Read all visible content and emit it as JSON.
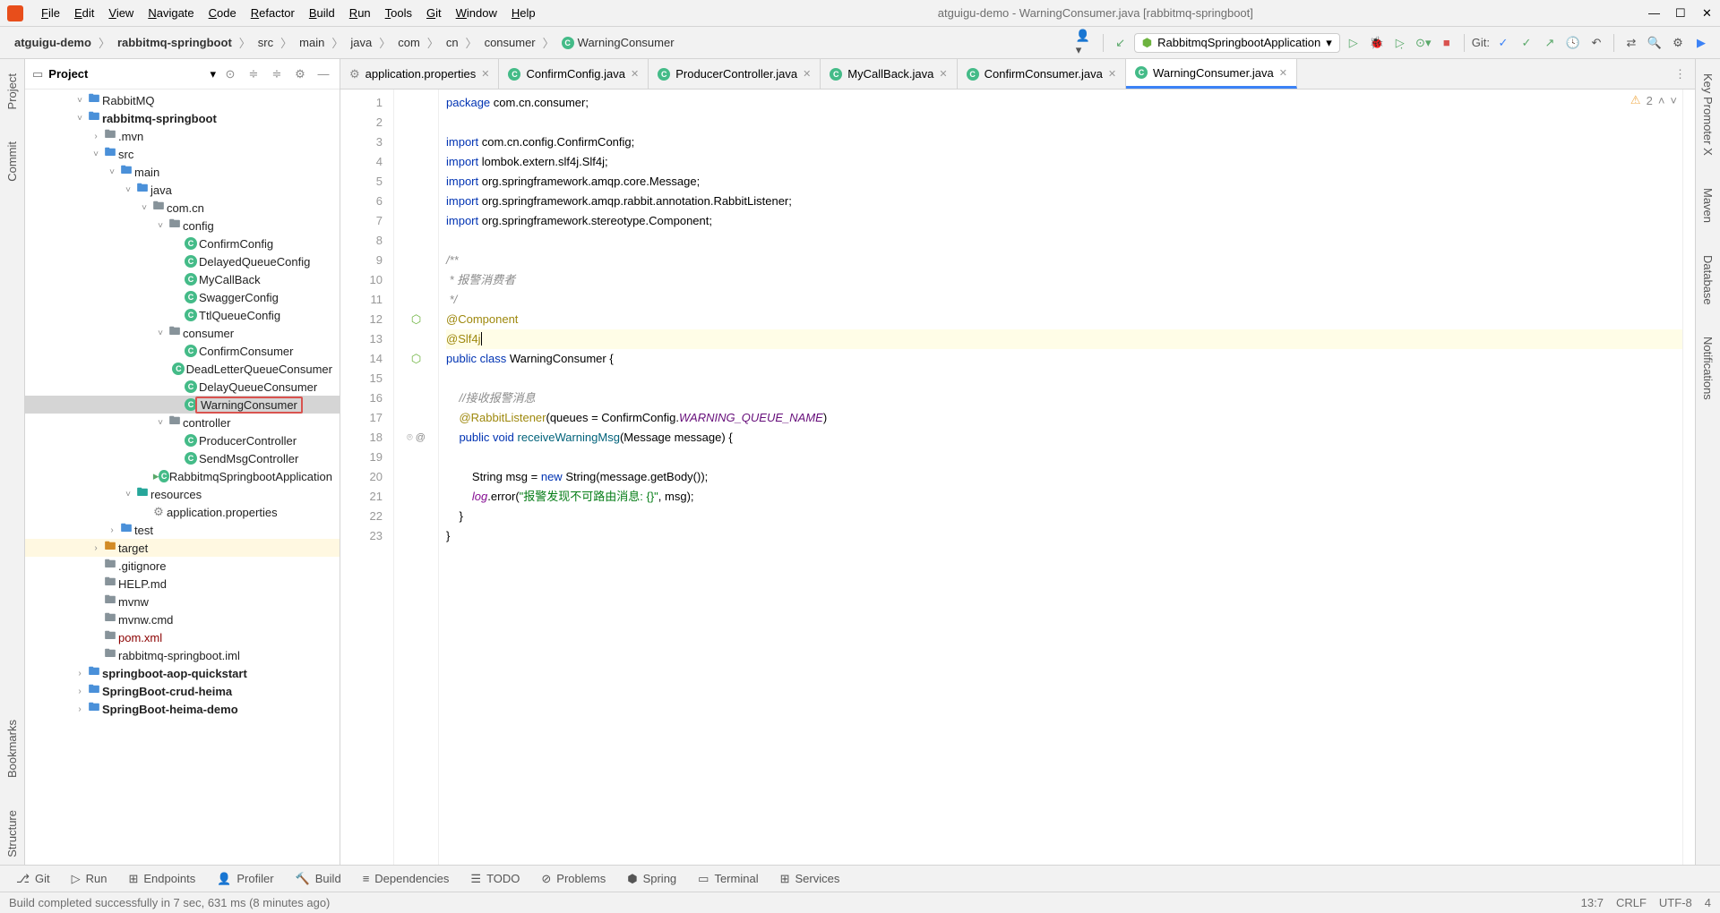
{
  "window_title": "atguigu-demo - WarningConsumer.java [rabbitmq-springboot]",
  "menu": [
    "File",
    "Edit",
    "View",
    "Navigate",
    "Code",
    "Refactor",
    "Build",
    "Run",
    "Tools",
    "Git",
    "Window",
    "Help"
  ],
  "breadcrumb": [
    "atguigu-demo",
    "rabbitmq-springboot",
    "src",
    "main",
    "java",
    "com",
    "cn",
    "consumer",
    "WarningConsumer"
  ],
  "run_config": "RabbitmqSpringbootApplication",
  "git_label": "Git:",
  "project_panel_title": "Project",
  "tree": [
    {
      "d": 3,
      "a": "d",
      "i": "folder-blue",
      "t": "RabbitMQ"
    },
    {
      "d": 3,
      "a": "d",
      "i": "folder-blue",
      "t": "rabbitmq-springboot",
      "b": true
    },
    {
      "d": 4,
      "a": "r",
      "i": "folder-i",
      "t": ".mvn"
    },
    {
      "d": 4,
      "a": "d",
      "i": "folder-blue",
      "t": "src"
    },
    {
      "d": 5,
      "a": "d",
      "i": "folder-blue",
      "t": "main"
    },
    {
      "d": 6,
      "a": "d",
      "i": "folder-blue",
      "t": "java"
    },
    {
      "d": 7,
      "a": "d",
      "i": "folder-i",
      "t": "com.cn"
    },
    {
      "d": 8,
      "a": "d",
      "i": "folder-i",
      "t": "config"
    },
    {
      "d": 9,
      "a": "",
      "i": "c",
      "t": "ConfirmConfig"
    },
    {
      "d": 9,
      "a": "",
      "i": "c",
      "t": "DelayedQueueConfig"
    },
    {
      "d": 9,
      "a": "",
      "i": "c",
      "t": "MyCallBack"
    },
    {
      "d": 9,
      "a": "",
      "i": "c",
      "t": "SwaggerConfig"
    },
    {
      "d": 9,
      "a": "",
      "i": "c",
      "t": "TtlQueueConfig"
    },
    {
      "d": 8,
      "a": "d",
      "i": "folder-i",
      "t": "consumer"
    },
    {
      "d": 9,
      "a": "",
      "i": "c",
      "t": "ConfirmConsumer"
    },
    {
      "d": 9,
      "a": "",
      "i": "c",
      "t": "DeadLetterQueueConsumer"
    },
    {
      "d": 9,
      "a": "",
      "i": "c",
      "t": "DelayQueueConsumer"
    },
    {
      "d": 9,
      "a": "",
      "i": "c",
      "t": "WarningConsumer",
      "sel": true,
      "box": true
    },
    {
      "d": 8,
      "a": "d",
      "i": "folder-i",
      "t": "controller"
    },
    {
      "d": 9,
      "a": "",
      "i": "c",
      "t": "ProducerController"
    },
    {
      "d": 9,
      "a": "",
      "i": "c",
      "t": "SendMsgController"
    },
    {
      "d": 8,
      "a": "",
      "i": "c",
      "t": "RabbitmqSpringbootApplication",
      "run": true
    },
    {
      "d": 6,
      "a": "d",
      "i": "folder-teal",
      "t": "resources"
    },
    {
      "d": 7,
      "a": "",
      "i": "cfg",
      "t": "application.properties"
    },
    {
      "d": 5,
      "a": "r",
      "i": "folder-blue",
      "t": "test"
    },
    {
      "d": 4,
      "a": "r",
      "i": "folder-orange",
      "t": "target",
      "tgt": true
    },
    {
      "d": 4,
      "a": "",
      "i": "file-i",
      "t": ".gitignore"
    },
    {
      "d": 4,
      "a": "",
      "i": "file-i",
      "t": "HELP.md"
    },
    {
      "d": 4,
      "a": "",
      "i": "file-i",
      "t": "mvnw"
    },
    {
      "d": 4,
      "a": "",
      "i": "file-i",
      "t": "mvnw.cmd"
    },
    {
      "d": 4,
      "a": "",
      "i": "file-i",
      "t": "pom.xml",
      "m": true
    },
    {
      "d": 4,
      "a": "",
      "i": "file-i",
      "t": "rabbitmq-springboot.iml"
    },
    {
      "d": 3,
      "a": "r",
      "i": "folder-blue",
      "t": "springboot-aop-quickstart",
      "b": true
    },
    {
      "d": 3,
      "a": "r",
      "i": "folder-blue",
      "t": "SpringBoot-crud-heima",
      "b": true
    },
    {
      "d": 3,
      "a": "r",
      "i": "folder-blue",
      "t": "SpringBoot-heima-demo",
      "b": true
    }
  ],
  "tabs": [
    {
      "icon": "cfg",
      "label": "application.properties"
    },
    {
      "icon": "c",
      "label": "ConfirmConfig.java"
    },
    {
      "icon": "c",
      "label": "ProducerController.java"
    },
    {
      "icon": "c",
      "label": "MyCallBack.java"
    },
    {
      "icon": "c",
      "label": "ConfirmConsumer.java"
    },
    {
      "icon": "c",
      "label": "WarningConsumer.java",
      "active": true
    }
  ],
  "code_lines": [
    {
      "n": 1,
      "h": "<span class='kw'>package</span> com.cn.consumer;"
    },
    {
      "n": 2,
      "h": ""
    },
    {
      "n": 3,
      "h": "<span class='kw'>import</span> com.cn.config.ConfirmConfig;"
    },
    {
      "n": 4,
      "h": "<span class='kw'>import</span> lombok.extern.slf4j.<span class='cls'>Slf4j</span>;"
    },
    {
      "n": 5,
      "h": "<span class='kw'>import</span> org.springframework.amqp.core.Message;"
    },
    {
      "n": 6,
      "h": "<span class='kw'>import</span> org.springframework.amqp.rabbit.annotation.<span class='cls'>RabbitListener</span>;"
    },
    {
      "n": 7,
      "h": "<span class='kw'>import</span> org.springframework.stereotype.<span class='cls'>Component</span>;"
    },
    {
      "n": 8,
      "h": ""
    },
    {
      "n": 9,
      "h": "<span class='cmt'>/**</span>"
    },
    {
      "n": 10,
      "h": "<span class='cmt'> * 报警消费者</span>"
    },
    {
      "n": 11,
      "h": "<span class='cmt'> */</span>"
    },
    {
      "n": 12,
      "h": "<span class='anno'>@Component</span>",
      "bean": true
    },
    {
      "n": 13,
      "h": "<span class='anno'>@Slf4j</span><span class='cursor'></span>",
      "hl": true
    },
    {
      "n": 14,
      "h": "<span class='kw'>public</span> <span class='kw'>class</span> <span class='cls'>WarningConsumer</span> {",
      "bean": true
    },
    {
      "n": 15,
      "h": ""
    },
    {
      "n": 16,
      "h": "    <span class='cmt'>//接收报警消息</span>"
    },
    {
      "n": 17,
      "h": "    <span class='anno'>@RabbitListener</span>(queues = ConfirmConfig.<span class='ital'>WARNING_QUEUE_NAME</span>)"
    },
    {
      "n": 18,
      "h": "    <span class='kw'>public</span> <span class='kw'>void</span> <span class='fn'>receiveWarningMsg</span>(Message message) {",
      "gut": "⌾  @"
    },
    {
      "n": 19,
      "h": ""
    },
    {
      "n": 20,
      "h": "        String msg = <span class='kw'>new</span> String(message.getBody());"
    },
    {
      "n": 21,
      "h": "        <span class='italg'>log</span>.error(<span class='str'>\"报警发现不可路由消息: {}\"</span>, msg);"
    },
    {
      "n": 22,
      "h": "    }"
    },
    {
      "n": 23,
      "h": "}"
    }
  ],
  "warn_count": "2",
  "bottom_tabs": [
    "Git",
    "Run",
    "Endpoints",
    "Profiler",
    "Build",
    "Dependencies",
    "TODO",
    "Problems",
    "Spring",
    "Terminal",
    "Services"
  ],
  "status_left": "Build completed successfully in 7 sec, 631 ms (8 minutes ago)",
  "status_right": [
    "13:7",
    "CRLF",
    "UTF-8",
    "4"
  ]
}
